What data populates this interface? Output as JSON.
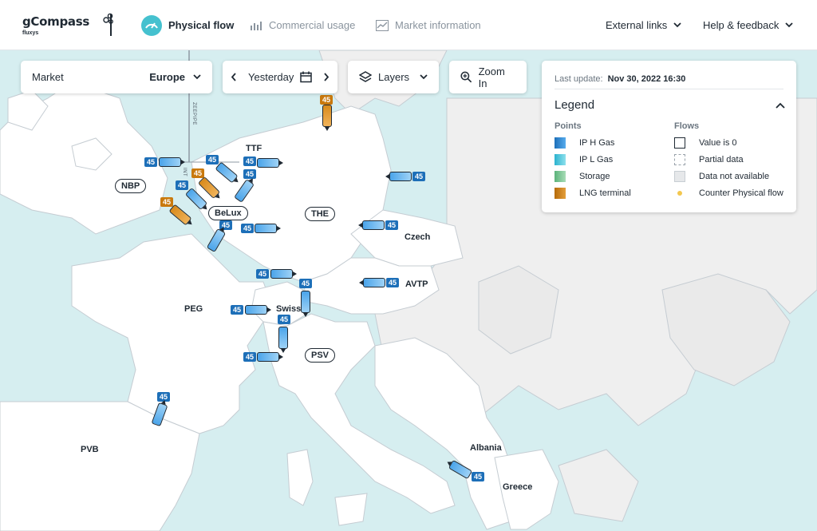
{
  "app": {
    "name": "gCompass",
    "brand_sub": "fluxys"
  },
  "nav": {
    "physical_flow": "Physical flow",
    "commercial_usage": "Commercial usage",
    "market_information": "Market information",
    "external_links": "External links",
    "help_feedback": "Help & feedback"
  },
  "toolbar": {
    "market_label": "Market",
    "market_value": "Europe",
    "date_value": "Yesterday",
    "layers_label": "Layers",
    "zoom_label": "Zoom In"
  },
  "legend": {
    "last_update_label": "Last update:",
    "last_update_value": "Nov 30, 2022 16:30",
    "title": "Legend",
    "points_header": "Points",
    "flows_header": "Flows",
    "points": [
      "IP H Gas",
      "IP L Gas",
      "Storage",
      "LNG terminal"
    ],
    "flows": [
      "Value is 0",
      "Partial data",
      "Data not available",
      "Counter Physical flow"
    ],
    "colors": {
      "ip_h_gas": "#2f86d1",
      "ip_l_gas": "#57c3df",
      "storage": "#86c99b",
      "lng": "#c9790d",
      "counter": "#f3c74f"
    }
  },
  "map": {
    "zones": {
      "nbp": "NBP",
      "belux": "BeLux",
      "the": "THE",
      "ttf": "TTF",
      "czech": "Czech",
      "avtp": "AVTP",
      "peg": "PEG",
      "swiss": "Swiss",
      "psv": "PSV",
      "pvb": "PVB",
      "albania": "Albania",
      "greece": "Greece"
    },
    "pipeline_labels": {
      "zeepipe": "ZEEPIPE",
      "int": "INT"
    },
    "flow_value": "45"
  },
  "colors": {
    "sea": "#d6eef0",
    "land": "#ffffff",
    "land_other": "#efefef",
    "border": "#c5ccd2"
  }
}
